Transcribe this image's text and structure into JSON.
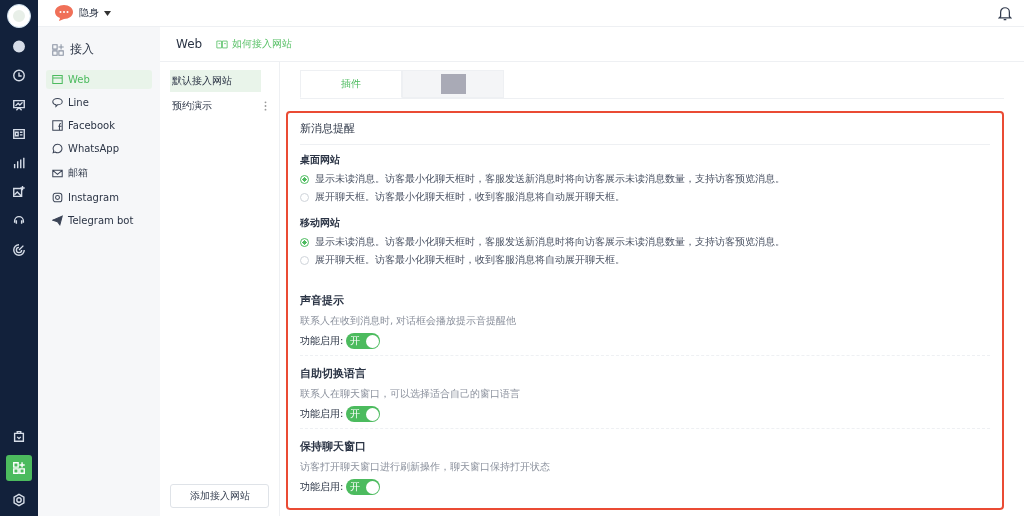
{
  "rail": {
    "top": [
      {
        "selected": false
      },
      {
        "selected": false
      },
      {
        "selected": false
      },
      {
        "selected": false
      },
      {
        "selected": false
      },
      {
        "selected": false
      },
      {
        "selected": false
      },
      {
        "selected": false
      }
    ],
    "bottom": [
      {
        "selected": false
      },
      {
        "selected": true
      },
      {
        "selected": false
      }
    ]
  },
  "topbar": {
    "status": "隐身"
  },
  "channels": {
    "title": "接入",
    "items": [
      {
        "label": "Web",
        "selected": true
      },
      {
        "label": "Line",
        "selected": false
      },
      {
        "label": "Facebook",
        "selected": false
      },
      {
        "label": "WhatsApp",
        "selected": false
      },
      {
        "label": "邮箱",
        "selected": false
      },
      {
        "label": "Instagram",
        "selected": false
      },
      {
        "label": "Telegram bot",
        "selected": false
      }
    ]
  },
  "header": {
    "title": "Web",
    "help_link": "如何接入网站"
  },
  "sites": {
    "items": [
      {
        "label": "默认接入网站",
        "selected": true
      },
      {
        "label": "预约演示",
        "selected": false
      }
    ],
    "add_button": "添加接入网站"
  },
  "tabs": [
    {
      "label": "插件",
      "selected": true
    },
    {
      "selected": false
    }
  ],
  "notify": {
    "title": "新消息提醒",
    "groups": [
      {
        "title": "桌面网站",
        "options": [
          {
            "label": "显示未读消息。访客最小化聊天框时，客服发送新消息时将向访客展示未读消息数量，支持访客预览消息。",
            "selected": true
          },
          {
            "label": "展开聊天框。访客最小化聊天框时，收到客服消息将自动展开聊天框。",
            "selected": false
          }
        ]
      },
      {
        "title": "移动网站",
        "options": [
          {
            "label": "显示未读消息。访客最小化聊天框时，客服发送新消息时将向访客展示未读消息数量，支持访客预览消息。",
            "selected": true
          },
          {
            "label": "展开聊天框。访客最小化聊天框时，收到客服消息将自动展开聊天框。",
            "selected": false
          }
        ]
      }
    ]
  },
  "features": [
    {
      "title": "声音提示",
      "description": "联系人在收到消息时, 对话框会播放提示音提醒他",
      "enable_label": "功能启用:",
      "toggle_text": "开",
      "on": true
    },
    {
      "title": "自助切换语言",
      "description": "联系人在聊天窗口，可以选择适合自己的窗口语言",
      "enable_label": "功能启用:",
      "toggle_text": "开",
      "on": true
    },
    {
      "title": "保持聊天窗口",
      "description": "访客打开聊天窗口进行刷新操作，聊天窗口保持打开状态",
      "enable_label": "功能启用:",
      "toggle_text": "开",
      "on": true
    }
  ]
}
